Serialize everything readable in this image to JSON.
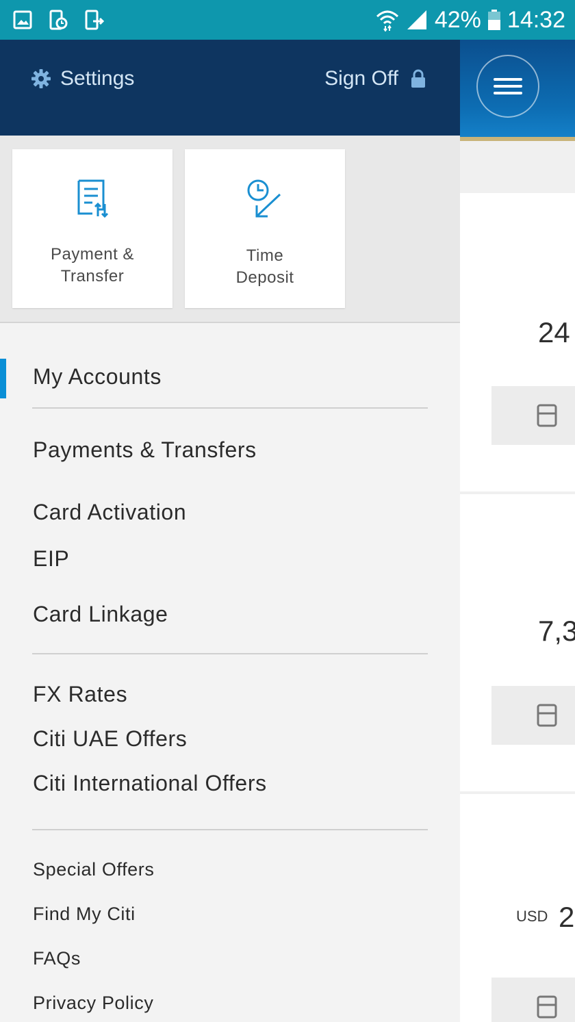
{
  "status_bar": {
    "battery": "42%",
    "time": "14:32",
    "left_icons": [
      "image-icon",
      "phone-clock-icon",
      "phone-exit-icon"
    ],
    "right_icons": [
      "wifi-icon",
      "signal-icon",
      "battery-icon"
    ]
  },
  "drawer": {
    "settings_label": "Settings",
    "signoff_label": "Sign Off",
    "quick_tiles": [
      {
        "label": "Payment &\nTransfer",
        "icon": "payment-transfer-icon"
      },
      {
        "label": "Time\nDeposit",
        "icon": "time-deposit-icon"
      }
    ],
    "menu": {
      "group1": [
        "My Accounts"
      ],
      "group2": [
        "Payments & Transfers",
        "Card Activation",
        "EIP",
        "Card Linkage"
      ],
      "group3": [
        "FX Rates",
        "Citi UAE Offers",
        "Citi International Offers"
      ],
      "group4": [
        "Special Offers",
        "Find My Citi",
        "FAQs",
        "Privacy Policy"
      ]
    },
    "active_item": "My Accounts"
  },
  "peek": {
    "amounts": [
      "24",
      "7,3",
      "2"
    ],
    "currency": "USD"
  },
  "colors": {
    "status_bar": "#0e97ad",
    "drawer_header": "#0e3560",
    "accent": "#0b8fd6",
    "gold_rule": "#c9b47a"
  }
}
